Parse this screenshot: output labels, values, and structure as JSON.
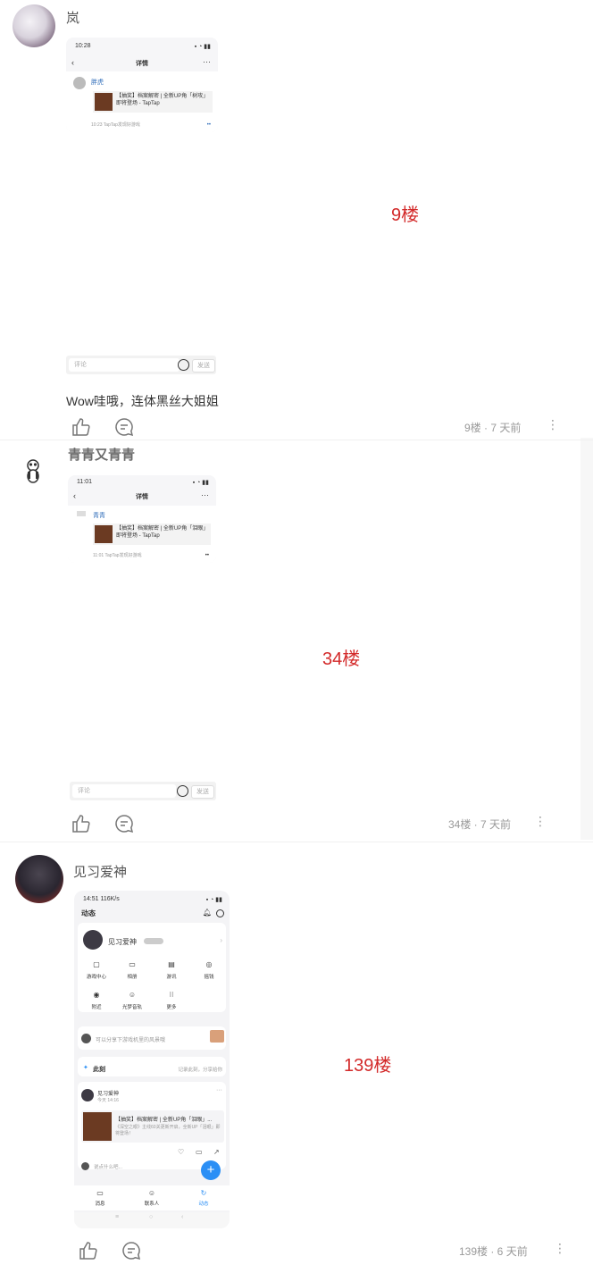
{
  "posts": [
    {
      "author": "岚",
      "screenshot": {
        "time": "10:28",
        "title": "详情",
        "user": "胖虎",
        "card_text": "【抽奖】档案解密 | 全新UP角「树攻」即将登场 - TapTap",
        "footer": "10:23 TapTap发现好游戏",
        "input_placeholder": "评论",
        "send_label": "发送"
      },
      "floor_label": "9楼",
      "comment": "Wow哇哦，连体黑丝大姐姐",
      "meta": "9楼 · 7 天前"
    },
    {
      "author": "青青又青青",
      "screenshot": {
        "time": "11:01",
        "title": "详情",
        "user": "青青",
        "card_text": "【抽奖】档案解密 | 全新UP角「泪眼」即将登场 - TapTap",
        "footer": "11:01 TapTap发现好游戏",
        "input_placeholder": "评论",
        "send_label": "发送"
      },
      "floor_label": "34楼",
      "meta": "34楼 · 7 天前"
    },
    {
      "author": "见习爱神",
      "screenshot": {
        "time": "14:51 116K/s",
        "header": "动态",
        "user": "见习爱神",
        "grid": [
          "游戏中心",
          "相册",
          "游讯",
          "摇钱",
          "附近",
          "光梦音轨",
          "更多"
        ],
        "share_prompt": "可以分享下游戏机里的风景哦",
        "moment_label": "此刻",
        "moment_hint": "记录此刻，分享给你",
        "post_user": "见习爱神",
        "post_time": "今天 14:16",
        "card_title": "【抽奖】档案解密 | 全新UP角「泪眼」...",
        "card_desc": "《深空之眼》主线60关更新开启，全新UP「泪眼」即将登场！",
        "comment_placeholder": "说点什么吧...",
        "nav": [
          "消息",
          "联系人",
          "动态"
        ]
      },
      "floor_label": "139楼",
      "meta": "139楼 · 6 天前"
    }
  ],
  "colors": {
    "floor": "#d32a2a",
    "meta": "#999999",
    "accent": "#2b8ff5"
  },
  "icons": [
    "like-icon",
    "comment-icon",
    "more-icon"
  ]
}
